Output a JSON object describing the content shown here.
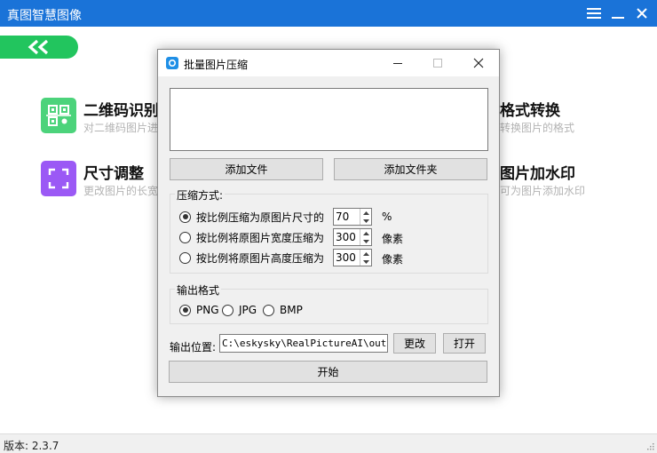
{
  "app": {
    "title": "真图智慧图像",
    "version_label": "版本: ",
    "version": "2.3.7"
  },
  "window_controls": [
    "menu-icon",
    "minimize-icon",
    "close-icon"
  ],
  "features": [
    {
      "title": "二维码识别",
      "desc": "对二维码图片进",
      "icon": "qrcode-icon",
      "color": "#4cd37b"
    },
    {
      "title": "格式转换",
      "desc": "转换图片的格式",
      "icon": "format-icon",
      "color": ""
    },
    {
      "title": "尺寸调整",
      "desc": "更改图片的长宽",
      "icon": "resize-icon",
      "color": "#9b59f5"
    },
    {
      "title": "图片加水印",
      "desc": "可为图片添加水印",
      "icon": "watermark-icon",
      "color": ""
    }
  ],
  "dialog": {
    "title": "批量图片压缩",
    "add_file": "添加文件",
    "add_folder": "添加文件夹",
    "compress_legend": "压缩方式:",
    "options": [
      {
        "label": "按比例压缩为原图片尺寸的",
        "value": "70",
        "unit": "%",
        "checked": true
      },
      {
        "label": "按比例将原图片宽度压缩为",
        "value": "300",
        "unit": "像素",
        "checked": false
      },
      {
        "label": "按比例将原图片高度压缩为",
        "value": "300",
        "unit": "像素",
        "checked": false
      }
    ],
    "format_legend": "输出格式",
    "formats": [
      {
        "label": "PNG",
        "checked": true
      },
      {
        "label": "JPG",
        "checked": false
      },
      {
        "label": "BMP",
        "checked": false
      }
    ],
    "output_label": "输出位置:",
    "output_path": "C:\\eskysky\\RealPictureAI\\output",
    "change_button": "更改",
    "open_button": "打开",
    "start_button": "开始"
  },
  "colors": {
    "titlebar": "#1a73d8",
    "back_button": "#22c55e"
  }
}
